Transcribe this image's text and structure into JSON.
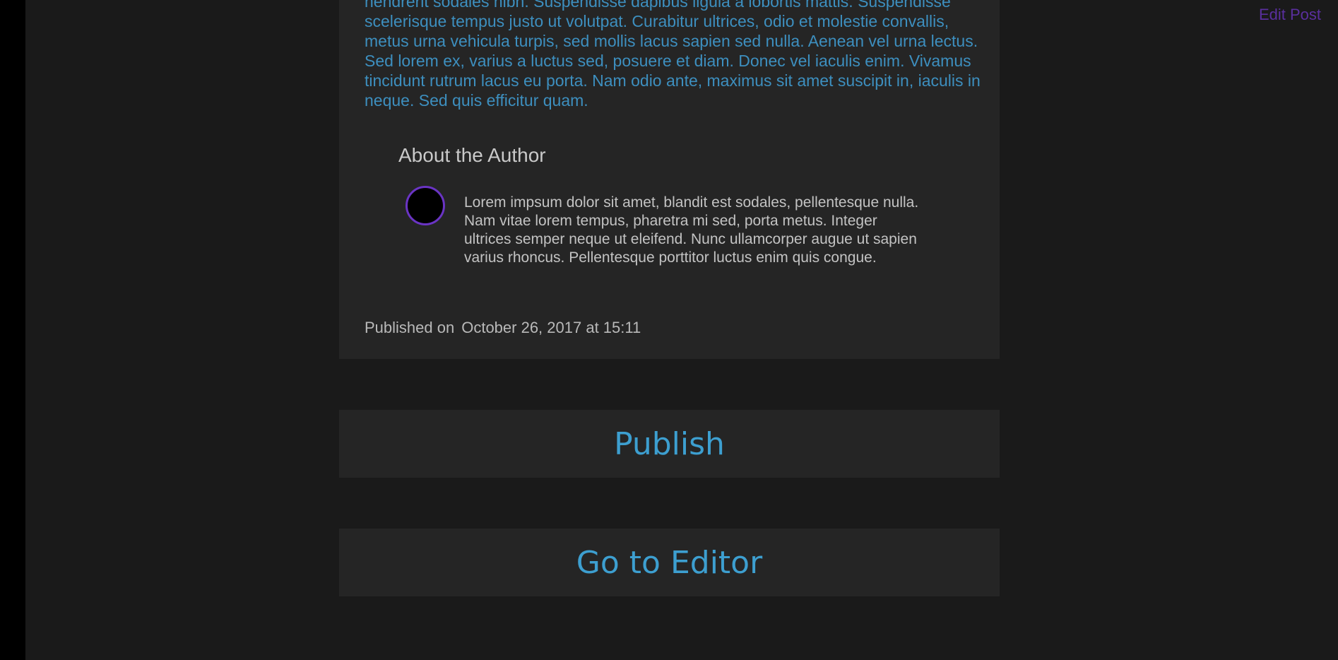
{
  "header": {
    "edit_post_label": "Edit Post"
  },
  "post": {
    "body_text": "hendrerit sodales nibh. Suspendisse dapibus ligula a lobortis mattis. Suspendisse scelerisque tempus justo ut volutpat. Curabitur ultrices, odio et molestie convallis, metus urna vehicula turpis, sed mollis lacus sapien sed nulla. Aenean vel urna lectus. Sed lorem ex, varius a luctus sed, posuere et diam. Donec vel iaculis enim. Vivamus tincidunt rutrum lacus eu porta. Nam odio ante, maximus sit amet suscipit in, iaculis in neque. Sed quis efficitur quam.",
    "published_label": "Published on",
    "published_date": "October 26, 2017 at 15:11"
  },
  "author": {
    "heading": "About the Author",
    "bio": "Lorem impsum dolor sit amet, blandit est sodales, pellentesque nulla. Nam vitae lorem tempus, pharetra mi sed, porta metus. Integer ultrices semper neque ut eleifend. Nunc ullamcorper augue ut sapien varius rhoncus. Pellentesque porttitor luctus enim quis congue."
  },
  "actions": {
    "publish_label": "Publish",
    "editor_label": "Go to Editor"
  },
  "colors": {
    "background": "#1a1a1a",
    "card": "#252525",
    "accent_blue": "#3d9fd0",
    "link_purple": "#5a2f9e",
    "avatar_border": "#6a34c4"
  }
}
